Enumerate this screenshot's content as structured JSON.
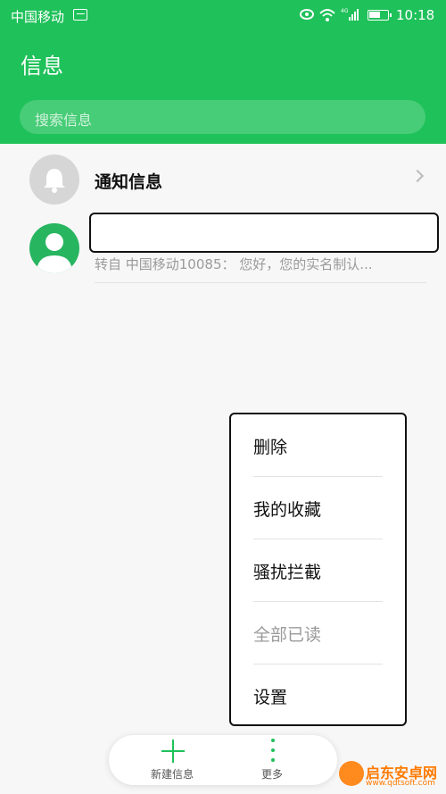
{
  "status_bar": {
    "carrier": "中国移动",
    "network": "4G",
    "time": "10:18"
  },
  "header": {
    "title": "信息",
    "search_placeholder": "搜索信息"
  },
  "conversations": [
    {
      "title": "通知信息",
      "icon": "bell-icon"
    },
    {
      "title": "",
      "preview": "转自 中国移动10085： 您好，您的实名制认...",
      "icon": "person-avatar-icon"
    }
  ],
  "context_menu": {
    "items": [
      {
        "label": "删除",
        "enabled": true
      },
      {
        "label": "我的收藏",
        "enabled": true
      },
      {
        "label": "骚扰拦截",
        "enabled": true
      },
      {
        "label": "全部已读",
        "enabled": false
      },
      {
        "label": "设置",
        "enabled": true
      }
    ]
  },
  "bottom_bar": {
    "new_message": "新建信息",
    "more": "更多"
  },
  "watermark": {
    "name": "启东安卓网",
    "url": "www.qdtsoft.com"
  },
  "colors": {
    "accent": "#1fc15a",
    "background": "#f7f7f7"
  }
}
